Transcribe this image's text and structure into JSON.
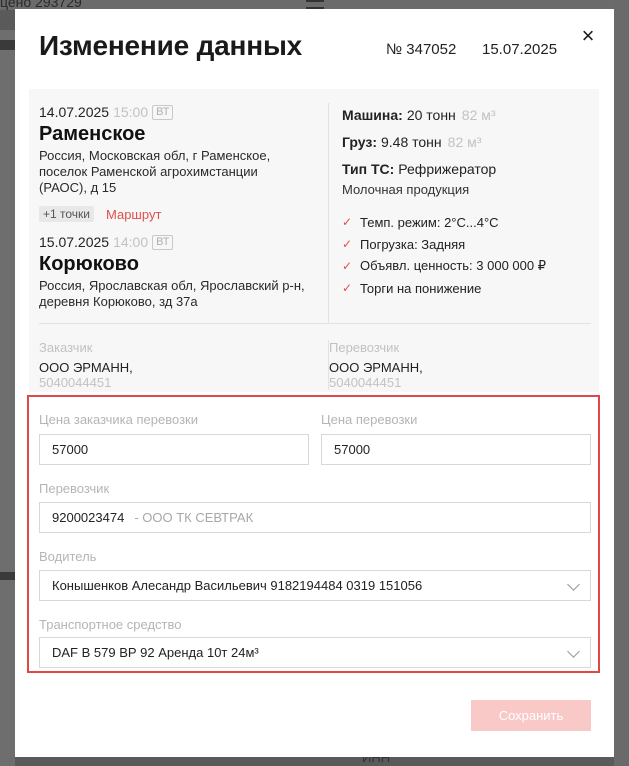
{
  "backdrop": {
    "top_text": "цено 293729",
    "bottom_text": "ИНН"
  },
  "modal": {
    "title": "Изменение данных",
    "order_number": "№ 347052",
    "order_date": "15.07.2025",
    "close_icon": "×"
  },
  "route": {
    "origin": {
      "date": "14.07.2025",
      "time": "15:00",
      "weekday": "ВТ",
      "city": "Раменское",
      "address": "Россия, Московская обл, г Раменское, поселок Раменской агрохимстанции (РАОС), д 15"
    },
    "extra_points": "+1 точки",
    "route_link": "Маршрут",
    "destination": {
      "date": "15.07.2025",
      "time": "14:00",
      "weekday": "ВТ",
      "city": "Корюково",
      "address": "Россия, Ярославская обл, Ярославский р-н, деревня Корюково, зд 37а"
    }
  },
  "specs": {
    "vehicle_label": "Машина:",
    "vehicle_value": "20 тонн",
    "vehicle_volume": "82 м³",
    "cargo_label": "Груз:",
    "cargo_value": "9.48 тонн",
    "cargo_volume": "82 м³",
    "ts_type_label": "Тип ТС:",
    "ts_type_value": "Рефрижератор",
    "cargo_name": "Молочная продукция",
    "conditions": [
      "Темп. режим: 2°C...4°C",
      "Погрузка: Задняя",
      "Объявл. ценность: 3 000 000 ₽",
      "Торги на понижение"
    ]
  },
  "parties": {
    "customer_label": "Заказчик",
    "customer_name": "ООО ЭРМАНН,",
    "customer_inn": "5040044451",
    "carrier_label": "Перевозчик",
    "carrier_name": "ООО ЭРМАНН,",
    "carrier_inn": "5040044451"
  },
  "form": {
    "customer_price_label": "Цена заказчика перевозки",
    "customer_price_value": "57000",
    "carrier_price_label": "Цена перевозки",
    "carrier_price_value": "57000",
    "carrier_label": "Перевозчик",
    "carrier_inn": "9200023474",
    "carrier_name_hint": "- ООО ТК СЕВТРАК",
    "driver_label": "Водитель",
    "driver_value": "Конышенков Алесандр Васильевич 9182194484 0319 151056",
    "vehicle_label": "Транспортное средство",
    "vehicle_value": "DAF В 579 ВР 92 Аренда 10т 24м³",
    "save_label": "Сохранить"
  },
  "colors": {
    "accent": "#e0504a",
    "highlight_border": "#e04848",
    "save_disabled": "#f8c9c7",
    "muted_text": "#c2c2c2"
  }
}
